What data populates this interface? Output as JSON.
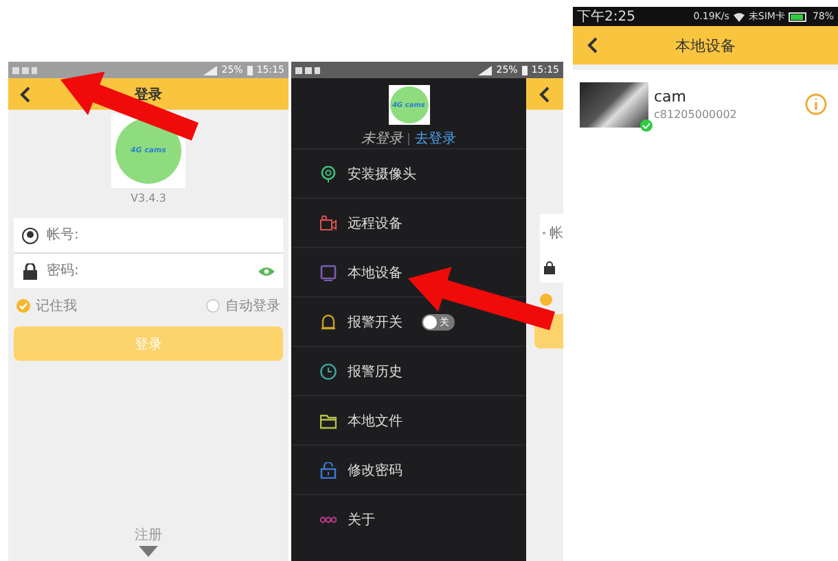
{
  "login_screen": {
    "status_bar": {
      "battery": "25%",
      "time": "15:15"
    },
    "title": "登录",
    "logo_text": "4G cams",
    "version": "V3.4.3",
    "fields": [
      {
        "kind": "account",
        "placeholder": "帐号:"
      },
      {
        "kind": "password",
        "placeholder": "密码:"
      }
    ],
    "options": [
      {
        "label": "记住我",
        "checked": true
      },
      {
        "label": "自动登录",
        "checked": false
      }
    ],
    "login_button": "登录",
    "register": "注册"
  },
  "drawer_screen": {
    "status_bar": {
      "battery": "25%",
      "time": "15:15"
    },
    "logo_text": "4G cams",
    "login_state": "未登录",
    "login_link": "去登录",
    "menu": [
      {
        "kind": "item",
        "label": "安装摄像头"
      },
      {
        "kind": "item",
        "label": "远程设备"
      },
      {
        "kind": "item",
        "label": "本地设备"
      },
      {
        "kind": "toggle",
        "label": "报警开关",
        "on": false,
        "toggle_label": "关"
      },
      {
        "kind": "item",
        "label": "报警历史"
      },
      {
        "kind": "item",
        "label": "本地文件"
      },
      {
        "kind": "item",
        "label": "修改密码"
      },
      {
        "kind": "item",
        "label": "关于"
      }
    ],
    "background_field": "帐"
  },
  "device_screen": {
    "status_bar": {
      "time": "下午2:25",
      "speed": "0.19K/s",
      "sim": "未SIM卡",
      "battery": "78%"
    },
    "title": "本地设备",
    "devices": [
      {
        "name": "cam",
        "id": "c81205000002",
        "online": true
      }
    ]
  }
}
